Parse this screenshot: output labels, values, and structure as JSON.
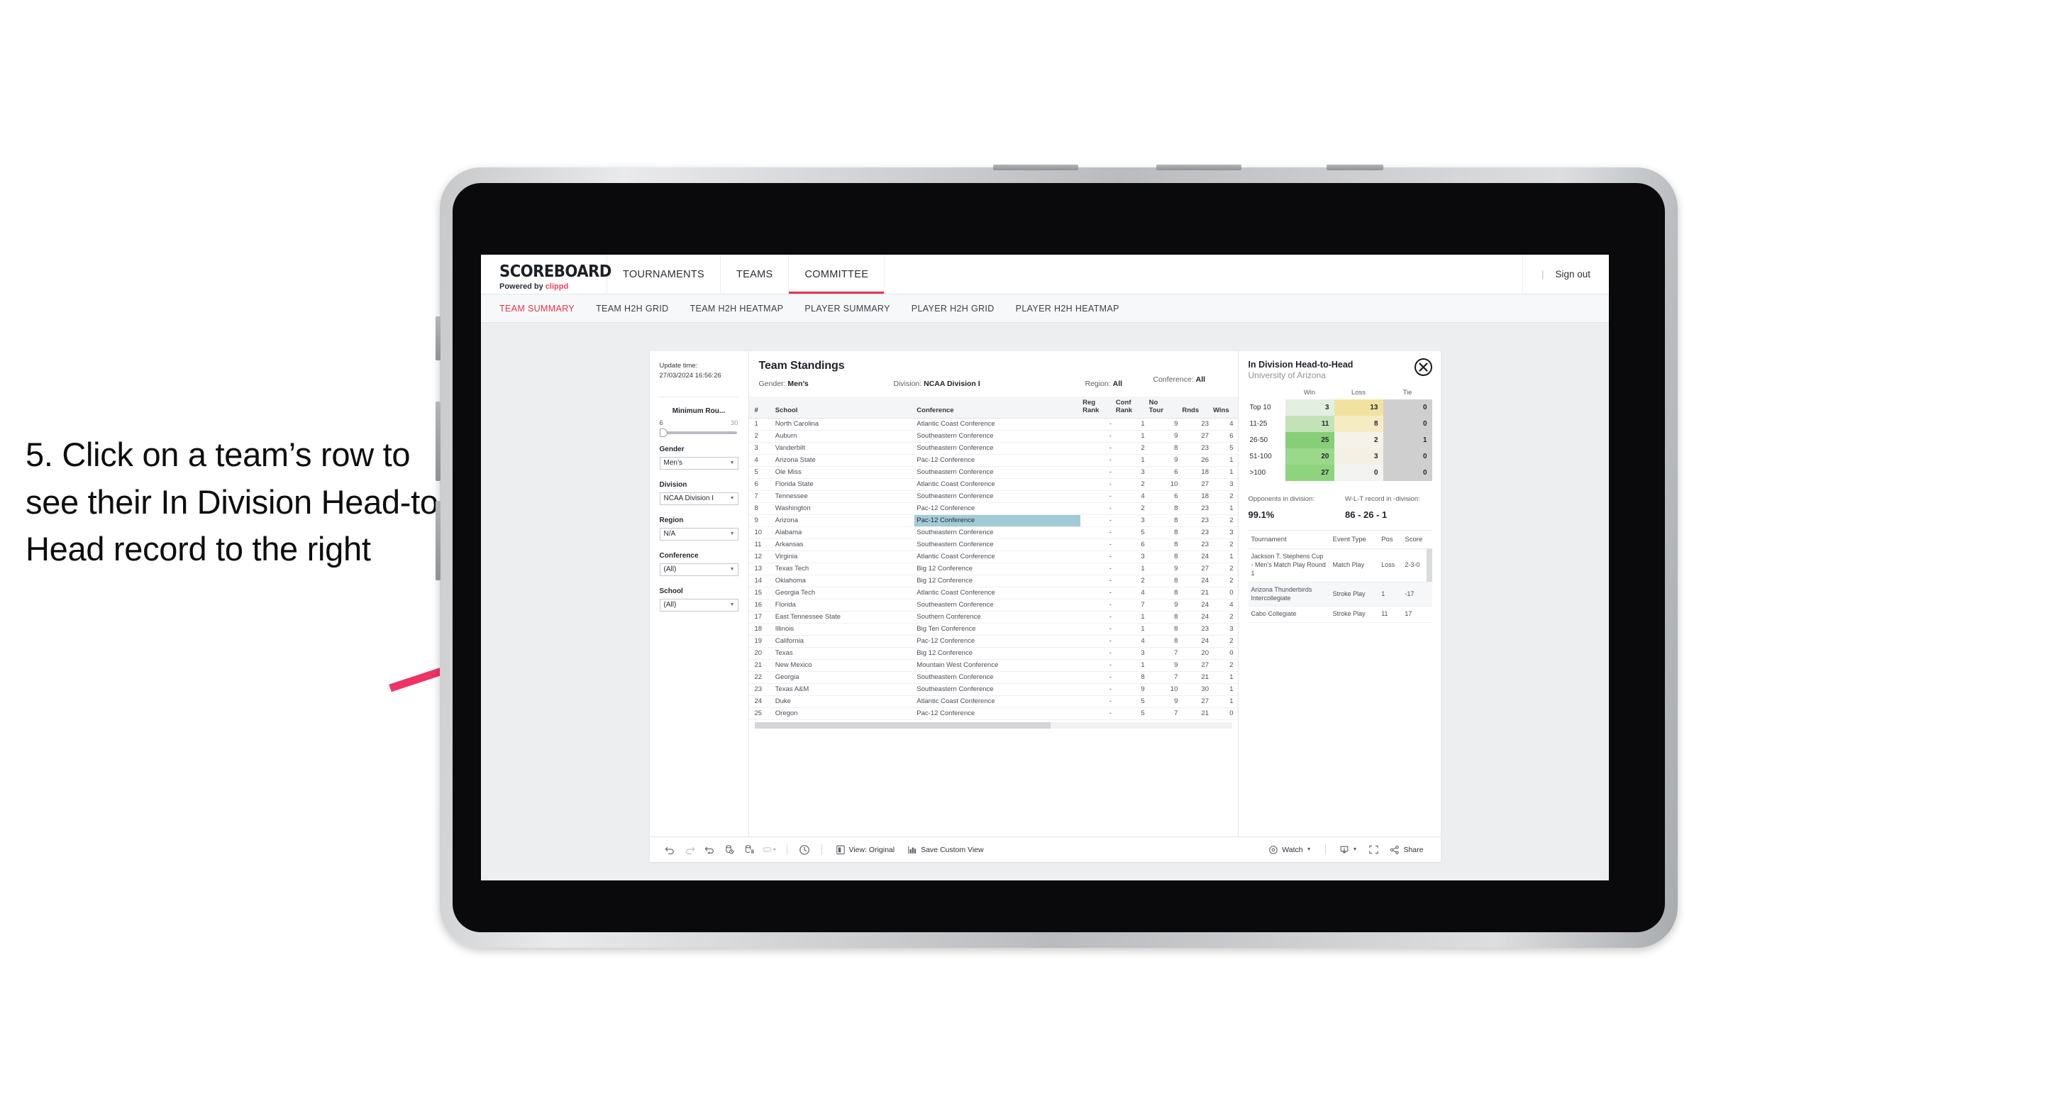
{
  "annotation": {
    "text": "5. Click on a team’s row to see their In Division Head-to-Head record to the right",
    "arrow_color": "#ee3366"
  },
  "topnav": {
    "brand_title": "SCOREBOARD",
    "brand_sub_prefix": "Powered by ",
    "brand_sub_brand": "clippd",
    "items": [
      {
        "label": "TOURNAMENTS",
        "active": false
      },
      {
        "label": "TEAMS",
        "active": false
      },
      {
        "label": "COMMITTEE",
        "active": true
      }
    ],
    "divider": "|",
    "signout_label": "Sign out",
    "accent": "#e8334a"
  },
  "subnav": {
    "items": [
      {
        "label": "TEAM SUMMARY",
        "active": true
      },
      {
        "label": "TEAM H2H GRID",
        "active": false
      },
      {
        "label": "TEAM H2H HEATMAP",
        "active": false
      },
      {
        "label": "PLAYER SUMMARY",
        "active": false
      },
      {
        "label": "PLAYER H2H GRID",
        "active": false
      },
      {
        "label": "PLAYER H2H HEATMAP",
        "active": false
      }
    ]
  },
  "filters": {
    "update_time_label": "Update time:",
    "update_time_value": "27/03/2024 16:56:26",
    "slider": {
      "label": "Minimum Rou...",
      "min": "6",
      "max": "30",
      "value": 6
    },
    "selects": [
      {
        "name": "gender",
        "label": "Gender",
        "value": "Men’s"
      },
      {
        "name": "division",
        "label": "Division",
        "value": "NCAA Division I"
      },
      {
        "name": "region",
        "label": "Region",
        "value": "N/A"
      },
      {
        "name": "conference",
        "label": "Conference",
        "value": "(All)"
      },
      {
        "name": "school",
        "label": "School",
        "value": "(All)"
      }
    ]
  },
  "standings": {
    "title": "Team Standings",
    "meta": [
      {
        "label": "Gender:",
        "value": "Men’s"
      },
      {
        "label": "Division:",
        "value": "NCAA Division I"
      },
      {
        "label": "Region:",
        "value": "All"
      },
      {
        "label": "Conference:",
        "value": "All"
      }
    ],
    "columns": [
      "#",
      "School",
      "Conference",
      "Reg Rank",
      "Conf Rank",
      "No Tour",
      "Rnds",
      "Wins"
    ],
    "columns_wrapped": [
      {
        "l1": "#",
        "l2": ""
      },
      {
        "l1": "School",
        "l2": ""
      },
      {
        "l1": "Conference",
        "l2": ""
      },
      {
        "l1": "Reg",
        "l2": "Rank"
      },
      {
        "l1": "Conf",
        "l2": "Rank"
      },
      {
        "l1": "No",
        "l2": "Tour"
      },
      {
        "l1": "Rnds",
        "l2": ""
      },
      {
        "l1": "Wins",
        "l2": ""
      }
    ],
    "selected_row_index": 8,
    "selection_color": "#a3cad7",
    "rows": [
      {
        "rank": "1",
        "school": "North Carolina",
        "conference": "Atlantic Coast Conference",
        "reg_rank": "-",
        "conf_rank": "1",
        "no_tour": "9",
        "rnds": "23",
        "wins": "4"
      },
      {
        "rank": "2",
        "school": "Auburn",
        "conference": "Southeastern Conference",
        "reg_rank": "-",
        "conf_rank": "1",
        "no_tour": "9",
        "rnds": "27",
        "wins": "6"
      },
      {
        "rank": "3",
        "school": "Vanderbilt",
        "conference": "Southeastern Conference",
        "reg_rank": "-",
        "conf_rank": "2",
        "no_tour": "8",
        "rnds": "23",
        "wins": "5"
      },
      {
        "rank": "4",
        "school": "Arizona State",
        "conference": "Pac-12 Conference",
        "reg_rank": "-",
        "conf_rank": "1",
        "no_tour": "9",
        "rnds": "26",
        "wins": "1"
      },
      {
        "rank": "5",
        "school": "Ole Miss",
        "conference": "Southeastern Conference",
        "reg_rank": "-",
        "conf_rank": "3",
        "no_tour": "6",
        "rnds": "18",
        "wins": "1"
      },
      {
        "rank": "6",
        "school": "Florida State",
        "conference": "Atlantic Coast Conference",
        "reg_rank": "-",
        "conf_rank": "2",
        "no_tour": "10",
        "rnds": "27",
        "wins": "3"
      },
      {
        "rank": "7",
        "school": "Tennessee",
        "conference": "Southeastern Conference",
        "reg_rank": "-",
        "conf_rank": "4",
        "no_tour": "6",
        "rnds": "18",
        "wins": "2"
      },
      {
        "rank": "8",
        "school": "Washington",
        "conference": "Pac-12 Conference",
        "reg_rank": "-",
        "conf_rank": "2",
        "no_tour": "8",
        "rnds": "23",
        "wins": "1"
      },
      {
        "rank": "9",
        "school": "Arizona",
        "conference": "Pac-12 Conference",
        "reg_rank": "-",
        "conf_rank": "3",
        "no_tour": "8",
        "rnds": "23",
        "wins": "2"
      },
      {
        "rank": "10",
        "school": "Alabama",
        "conference": "Southeastern Conference",
        "reg_rank": "-",
        "conf_rank": "5",
        "no_tour": "8",
        "rnds": "23",
        "wins": "3"
      },
      {
        "rank": "11",
        "school": "Arkansas",
        "conference": "Southeastern Conference",
        "reg_rank": "-",
        "conf_rank": "6",
        "no_tour": "8",
        "rnds": "23",
        "wins": "2"
      },
      {
        "rank": "12",
        "school": "Virginia",
        "conference": "Atlantic Coast Conference",
        "reg_rank": "-",
        "conf_rank": "3",
        "no_tour": "8",
        "rnds": "24",
        "wins": "1"
      },
      {
        "rank": "13",
        "school": "Texas Tech",
        "conference": "Big 12 Conference",
        "reg_rank": "-",
        "conf_rank": "1",
        "no_tour": "9",
        "rnds": "27",
        "wins": "2"
      },
      {
        "rank": "14",
        "school": "Oklahoma",
        "conference": "Big 12 Conference",
        "reg_rank": "-",
        "conf_rank": "2",
        "no_tour": "8",
        "rnds": "24",
        "wins": "2"
      },
      {
        "rank": "15",
        "school": "Georgia Tech",
        "conference": "Atlantic Coast Conference",
        "reg_rank": "-",
        "conf_rank": "4",
        "no_tour": "8",
        "rnds": "21",
        "wins": "0"
      },
      {
        "rank": "16",
        "school": "Florida",
        "conference": "Southeastern Conference",
        "reg_rank": "-",
        "conf_rank": "7",
        "no_tour": "9",
        "rnds": "24",
        "wins": "4"
      },
      {
        "rank": "17",
        "school": "East Tennessee State",
        "conference": "Southern Conference",
        "reg_rank": "-",
        "conf_rank": "1",
        "no_tour": "8",
        "rnds": "24",
        "wins": "2"
      },
      {
        "rank": "18",
        "school": "Illinois",
        "conference": "Big Ten Conference",
        "reg_rank": "-",
        "conf_rank": "1",
        "no_tour": "8",
        "rnds": "23",
        "wins": "3"
      },
      {
        "rank": "19",
        "school": "California",
        "conference": "Pac-12 Conference",
        "reg_rank": "-",
        "conf_rank": "4",
        "no_tour": "8",
        "rnds": "24",
        "wins": "2"
      },
      {
        "rank": "20",
        "school": "Texas",
        "conference": "Big 12 Conference",
        "reg_rank": "-",
        "conf_rank": "3",
        "no_tour": "7",
        "rnds": "20",
        "wins": "0"
      },
      {
        "rank": "21",
        "school": "New Mexico",
        "conference": "Mountain West Conference",
        "reg_rank": "-",
        "conf_rank": "1",
        "no_tour": "9",
        "rnds": "27",
        "wins": "2"
      },
      {
        "rank": "22",
        "school": "Georgia",
        "conference": "Southeastern Conference",
        "reg_rank": "-",
        "conf_rank": "8",
        "no_tour": "7",
        "rnds": "21",
        "wins": "1"
      },
      {
        "rank": "23",
        "school": "Texas A&M",
        "conference": "Southeastern Conference",
        "reg_rank": "-",
        "conf_rank": "9",
        "no_tour": "10",
        "rnds": "30",
        "wins": "1"
      },
      {
        "rank": "24",
        "school": "Duke",
        "conference": "Atlantic Coast Conference",
        "reg_rank": "-",
        "conf_rank": "5",
        "no_tour": "9",
        "rnds": "27",
        "wins": "1"
      },
      {
        "rank": "25",
        "school": "Oregon",
        "conference": "Pac-12 Conference",
        "reg_rank": "-",
        "conf_rank": "5",
        "no_tour": "7",
        "rnds": "21",
        "wins": "0"
      }
    ]
  },
  "h2h": {
    "title": "In Division Head-to-Head",
    "subtitle": "University of Arizona",
    "close_icon": "close-icon",
    "columns": [
      "",
      "Win",
      "Loss",
      "Tie"
    ],
    "rows": [
      {
        "bucket": "Top 10",
        "win": "3",
        "loss": "13",
        "tie": "0",
        "win_color": "#e3efe0",
        "loss_color": "#f2e2a0",
        "tie_color": "#cfcfcf"
      },
      {
        "bucket": "11-25",
        "win": "11",
        "loss": "8",
        "tie": "0",
        "win_color": "#c3e2b8",
        "loss_color": "#f6ecc4",
        "tie_color": "#cfcfcf"
      },
      {
        "bucket": "26-50",
        "win": "25",
        "loss": "2",
        "tie": "1",
        "win_color": "#86ce78",
        "loss_color": "#f4f2e9",
        "tie_color": "#cfcfcf"
      },
      {
        "bucket": "51-100",
        "win": "20",
        "loss": "3",
        "tie": "0",
        "win_color": "#9ad88a",
        "loss_color": "#f4f0e4",
        "tie_color": "#cfcfcf"
      },
      {
        "bucket": ">100",
        "win": "27",
        "loss": "0",
        "tie": "0",
        "win_color": "#8ed37e",
        "loss_color": "#f3f3f1",
        "tie_color": "#cfcfcf"
      }
    ],
    "stats": [
      {
        "label": "Opponents in division:",
        "value": "99.1%"
      },
      {
        "label": "W-L-T record in -division:",
        "value": "86 - 26 - 1"
      }
    ],
    "tournaments": {
      "columns": [
        "Tournament",
        "Event Type",
        "Pos",
        "Score"
      ],
      "rows": [
        {
          "name": "Jackson T. Stephens Cup - Men’s Match Play Round 1",
          "event_type": "Match Play",
          "pos": "Loss",
          "score": "2-3-0"
        },
        {
          "name": "Arizona Thunderbirds Intercollegiate",
          "event_type": "Stroke Play",
          "pos": "1",
          "score": "-17"
        },
        {
          "name": "Cabo Collegiate",
          "event_type": "Stroke Play",
          "pos": "11",
          "score": "17"
        }
      ]
    }
  },
  "toolbar": {
    "icons": [
      {
        "name": "undo-icon"
      },
      {
        "name": "redo-icon"
      },
      {
        "name": "revert-icon"
      },
      {
        "name": "refresh-data-icon"
      },
      {
        "name": "pause-auto-updates-icon"
      },
      {
        "name": "alerts-dropdown-icon"
      }
    ],
    "history_icon": "view-history-icon",
    "view_original_label": "View: Original",
    "view_original_icon": "device-preview-icon",
    "save_custom_view_label": "Save Custom View",
    "save_custom_view_icon": "save-view-icon",
    "watch_label": "Watch",
    "watch_icon": "eye-icon",
    "download_icon": "download-icon",
    "fullscreen_icon": "fullscreen-icon",
    "share_label": "Share",
    "share_icon": "share-icon"
  }
}
